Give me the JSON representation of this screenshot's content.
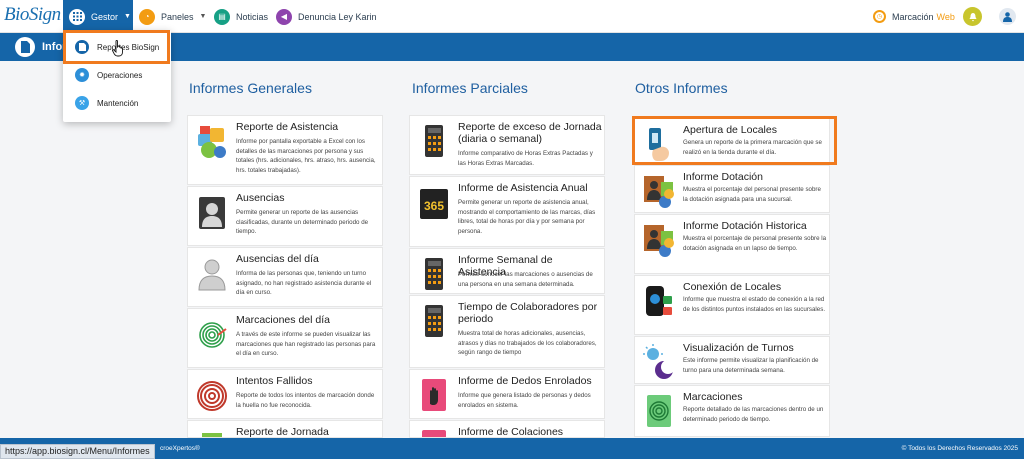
{
  "logo": {
    "text": "BioSign"
  },
  "nav": {
    "gestor": "Gestor",
    "paneles": "Paneles",
    "noticias": "Noticias",
    "denuncia": "Denuncia Ley Karin",
    "marcacion": "Marcación",
    "web": "Web"
  },
  "header": {
    "title": "Infor"
  },
  "dropdown": {
    "items": [
      {
        "label": "Reportes BioSign",
        "icon": "document-icon"
      },
      {
        "label": "Operaciones",
        "icon": "gear-icon"
      },
      {
        "label": "Mantención",
        "icon": "wrench-icon"
      }
    ]
  },
  "columns": {
    "generales": {
      "title": "Informes Generales",
      "cards": [
        {
          "title": "Reporte de Asistencia",
          "desc": "Informe por pantalla exportable a Excel con los detalles de las marcaciones por persona y sus totales (hrs. adicionales, hrs. atraso, hrs. ausencia, hrs. totales trabajadas).",
          "icon": "attendance-report-icon"
        },
        {
          "title": "Ausencias",
          "desc": "Permite generar un reporte de las ausencias clasificadas, durante un determinado periodo de tiempo.",
          "icon": "absence-person-icon"
        },
        {
          "title": "Ausencias del día",
          "desc": "Informa de las personas que, teniendo un turno asignado, no han registrado asistencia durante el día en curso.",
          "icon": "person-outline-icon"
        },
        {
          "title": "Marcaciones del día",
          "desc": "A través de este informe se pueden visualizar las marcaciones que han registrado las personas para el día en curso.",
          "icon": "fingerprint-green-icon"
        },
        {
          "title": "Intentos Fallidos",
          "desc": "Reporte de todos los intentos de marcación donde la huella no fue reconocida.",
          "icon": "fingerprint-red-icon"
        },
        {
          "title": "Reporte de Jornada",
          "desc": "",
          "icon": "schedule-icon"
        }
      ]
    },
    "parciales": {
      "title": "Informes Parciales",
      "cards": [
        {
          "title": "Reporte de exceso de Jornada (diaria o semanal)",
          "desc": "Informe comparativo de Horas Extras Pactadas y las Horas Extras Marcadas.",
          "icon": "calculator-icon"
        },
        {
          "title": "Informe de Asistencia Anual",
          "desc": "Permite generar un reporte de asistencia anual, mostrando el comportamiento de las marcas, días libres, total de horas por día y por semana por persona.",
          "icon": "calendar-365-icon"
        },
        {
          "title": "Informe Semanal de Asistencia",
          "desc": "Permite conocer las marcaciones o ausencias de una persona en una semana determinada.",
          "icon": "calculator-icon"
        },
        {
          "title": "Tiempo de Colaboradores por periodo",
          "desc": "Muestra total de horas adicionales, ausencias, atrasos y días no trabajados de los colaboradores, según rango de tiempo",
          "icon": "calculator-icon"
        },
        {
          "title": "Informe de Dedos Enrolados",
          "desc": "Informe que genera listado de personas y dedos enrolados en sistema.",
          "icon": "hand-pink-icon"
        },
        {
          "title": "Informe de Colaciones",
          "desc": "",
          "icon": "hand-pink-icon"
        }
      ]
    },
    "otros": {
      "title": "Otros Informes",
      "cards": [
        {
          "title": "Apertura de Locales",
          "desc": "Genera un reporte de la primera marcación que se realizó en la tienda durante el día.",
          "icon": "hand-device-icon"
        },
        {
          "title": "Informe Dotación",
          "desc": "Muestra el porcentaje del personal presente sobre la dotación asignada para una sucursal.",
          "icon": "staff-report-icon"
        },
        {
          "title": "Informe Dotación Historica",
          "desc": "Muestra el porcentaje de personal presente sobre la dotación asignada en un lapso de tiempo.",
          "icon": "staff-report-icon"
        },
        {
          "title": "Conexión de Locales",
          "desc": "Informe que muestra el estado de conexión a la red de los distintos puntos instalados en las sucursales.",
          "icon": "connection-device-icon"
        },
        {
          "title": "Visualización de Turnos",
          "desc": "Este informe permite visualizar la planificación de turno para una determinada semana.",
          "icon": "sun-moon-icon"
        },
        {
          "title": "Marcaciones",
          "desc": "Reporte detallado de las marcaciones dentro de un determinado periodo de tiempo.",
          "icon": "fingerprint-green-icon"
        }
      ]
    }
  },
  "footer": {
    "brand": "croeXpertos®",
    "copyright": "© Todos los Derechos Reservados 2025"
  },
  "status_url": "https://app.biosign.cl/Menu/Informes",
  "colors": {
    "primary": "#1565a8",
    "highlight": "#f07a1e",
    "title": "#1f5fa0"
  }
}
